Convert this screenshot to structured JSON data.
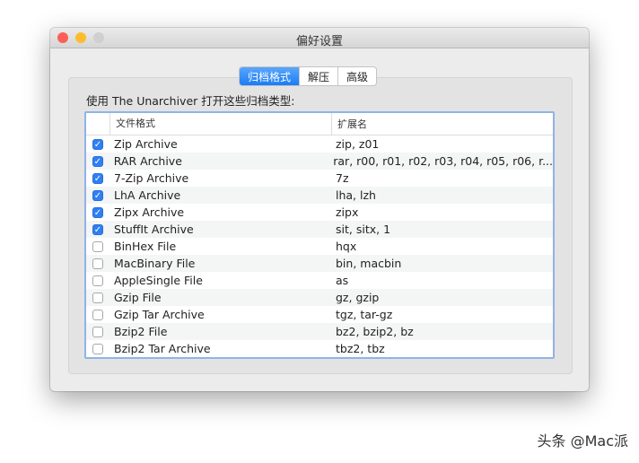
{
  "window": {
    "title": "偏好设置"
  },
  "tabs": [
    {
      "label": "归档格式",
      "active": true
    },
    {
      "label": "解压",
      "active": false
    },
    {
      "label": "高级",
      "active": false
    }
  ],
  "intro": "使用 The Unarchiver 打开这些归档类型:",
  "table": {
    "headers": [
      "文件格式",
      "扩展名"
    ],
    "rows": [
      {
        "checked": true,
        "format": "Zip Archive",
        "ext": "zip, z01"
      },
      {
        "checked": true,
        "format": "RAR Archive",
        "ext": "rar, r00, r01, r02, r03, r04, r05, r06, r..."
      },
      {
        "checked": true,
        "format": "7-Zip Archive",
        "ext": "7z"
      },
      {
        "checked": true,
        "format": "LhA Archive",
        "ext": "lha, lzh"
      },
      {
        "checked": true,
        "format": "Zipx Archive",
        "ext": "zipx"
      },
      {
        "checked": true,
        "format": "StuffIt Archive",
        "ext": "sit, sitx, 1"
      },
      {
        "checked": false,
        "format": "BinHex File",
        "ext": "hqx"
      },
      {
        "checked": false,
        "format": "MacBinary File",
        "ext": "bin, macbin"
      },
      {
        "checked": false,
        "format": "AppleSingle File",
        "ext": "as"
      },
      {
        "checked": false,
        "format": "Gzip File",
        "ext": "gz, gzip"
      },
      {
        "checked": false,
        "format": "Gzip Tar Archive",
        "ext": "tgz, tar-gz"
      },
      {
        "checked": false,
        "format": "Bzip2 File",
        "ext": "bz2, bzip2, bz"
      },
      {
        "checked": false,
        "format": "Bzip2 Tar Archive",
        "ext": "tbz2, tbz"
      }
    ]
  },
  "watermark": "头条 @Mac派",
  "colors": {
    "accent": "#1a7cf5",
    "close": "#fc5f57",
    "minimize": "#fdbc2e",
    "zoom": "#cfcfcf"
  }
}
